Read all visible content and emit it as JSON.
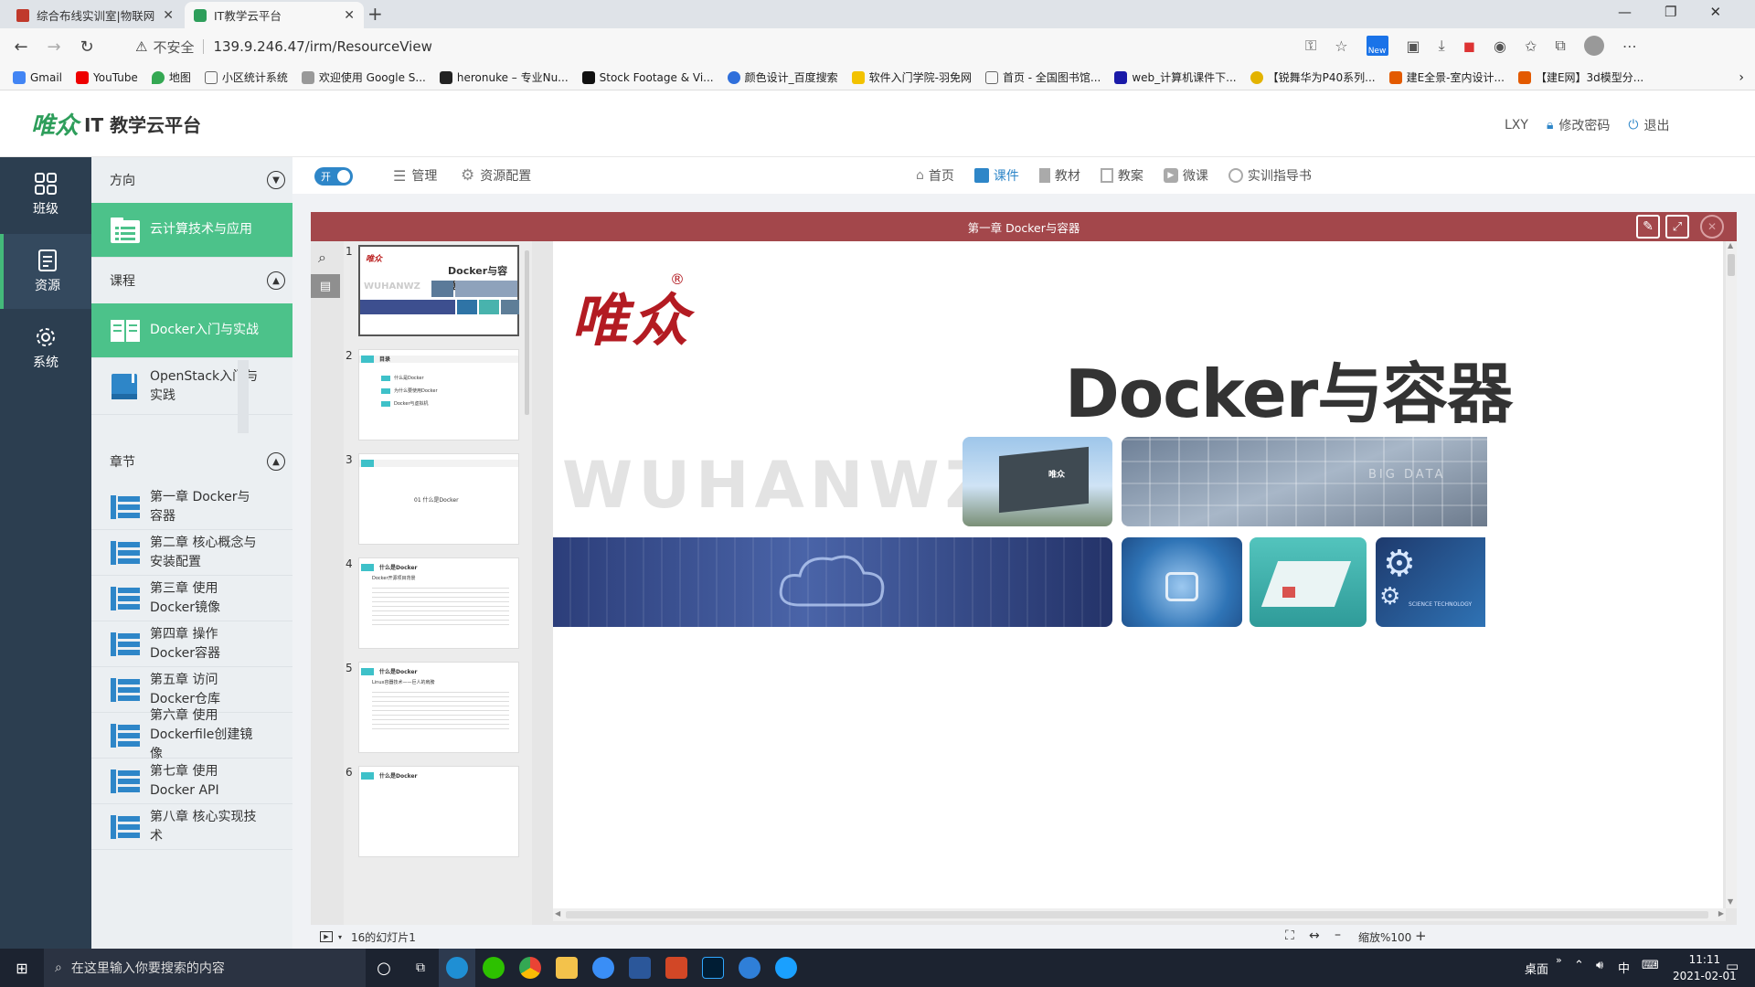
{
  "browser": {
    "tabs": [
      {
        "title": "综合布线实训室|物联网实训室|..."
      },
      {
        "title": "IT教学云平台"
      }
    ],
    "new_tab": "+",
    "security": "不安全",
    "url": "139.9.246.47/irm/ResourceView",
    "badge_new": "New",
    "bookmarks": [
      "Gmail",
      "YouTube",
      "地图",
      "小区统计系统",
      "欢迎使用 Google S...",
      "heronuke – 专业Nu...",
      "Stock Footage & Vi...",
      "颜色设计_百度搜索",
      "软件入门学院-羽免网",
      "首页 - 全国图书馆...",
      "web_计算机课件下...",
      "【锐舞华为P40系列...",
      "建E全景-室内设计...",
      "【建E网】3d模型分..."
    ]
  },
  "app": {
    "logo_text": "唯众",
    "title": "IT 教学云平台",
    "user": "LXY",
    "change_password": "修改密码",
    "logout": "退出"
  },
  "rail": [
    {
      "label": "班级"
    },
    {
      "label": "资源"
    },
    {
      "label": "系统"
    }
  ],
  "side": {
    "direction_header": "方向",
    "direction_item": "云计算技术与应用",
    "course_header": "课程",
    "courses": [
      "Docker入门与实战",
      "OpenStack入门与实践"
    ],
    "chapter_header": "章节",
    "chapters": [
      "第一章 Docker与容器",
      "第二章 核心概念与安装配置",
      "第三章 使用Docker镜像",
      "第四章 操作Docker容器",
      "第五章 访问Docker仓库",
      "第六章 使用Dockerfile创建镜像",
      "第七章 使用Docker API",
      "第八章 核心实现技术"
    ]
  },
  "toolbar": {
    "toggle_label": "开",
    "manage": "管理",
    "resource_config": "资源配置",
    "nav": [
      "首页",
      "课件",
      "教材",
      "教案",
      "微课",
      "实训指导书"
    ]
  },
  "viewer": {
    "title": "第一章 Docker与容器",
    "slide_title": "Docker与容器",
    "slide_logo": "唯众",
    "slide_watermark": "WUHANWZ",
    "slide_caption_bigdata": "BIG DATA",
    "slide_caption_science": "SCIENCE TECHNOLOGY",
    "building_sign": "唯众",
    "thumbs": [
      {
        "num": "1",
        "title": "Docker与容器",
        "watermark": "WUHANWZ"
      },
      {
        "num": "2",
        "title": "目录",
        "lines": [
          "什么是Docker",
          "为什么要使用Docker",
          "Docker与虚拟机"
        ]
      },
      {
        "num": "3",
        "text": "01 什么是Docker"
      },
      {
        "num": "4",
        "title": "什么是Docker",
        "sub": "Docker开源项目背景"
      },
      {
        "num": "5",
        "title": "什么是Docker",
        "sub": "Linux容器技术——巨人的肩膀"
      },
      {
        "num": "6",
        "title": "什么是Docker"
      }
    ],
    "status_slide": "16的幻灯片1",
    "zoom": "缩放%100",
    "zoom_minus": "–",
    "zoom_plus": "+"
  },
  "taskbar": {
    "search_placeholder": "在这里输入你要搜索的内容",
    "desktop": "桌面",
    "ime": "中",
    "time": "11:11",
    "date": "2021-02-01"
  },
  "colors": {
    "sidebar_dark": "#2c3e50",
    "green": "#4cc28a",
    "red_title": "#a3474b",
    "blue_accent": "#2e86c8",
    "teal": "#3ec1c9"
  }
}
